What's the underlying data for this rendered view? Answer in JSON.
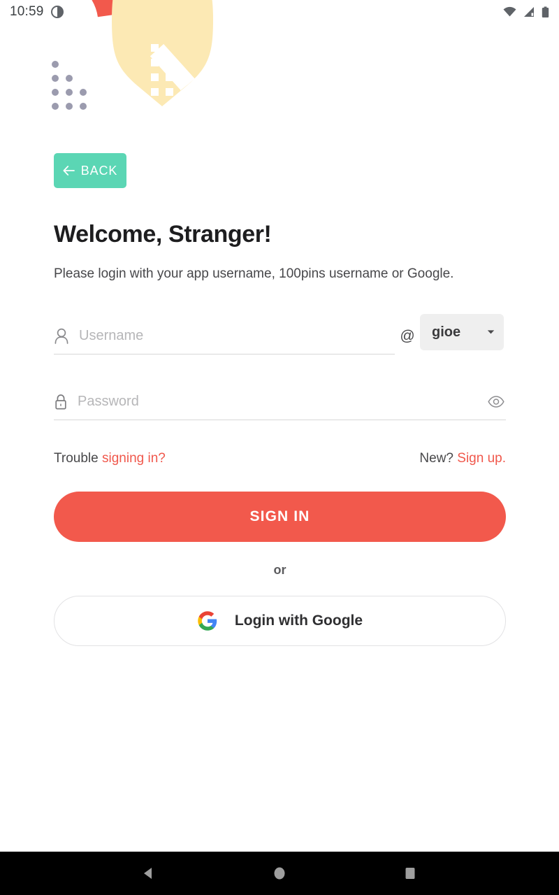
{
  "status_bar": {
    "clock": "10:59",
    "icons": [
      "contrast-circle-icon",
      "wifi-icon",
      "cellular-signal-icon",
      "battery-icon"
    ]
  },
  "header_art": {
    "arc_color": "#F2594C",
    "blob_color": "#FCE9B4",
    "dot_color": "#9B9BAE",
    "inner_dot_color": "#FFFFFF"
  },
  "back_button": {
    "label": "BACK",
    "icon": "arrow-left-icon",
    "color": "#5BD6B4"
  },
  "main": {
    "title": "Welcome, Stranger!",
    "subtitle": "Please login with your app username, 100pins username or Google.",
    "username": {
      "icon": "person-icon",
      "placeholder": "Username",
      "value": "",
      "at_symbol": "@",
      "domain_selected": "gioe",
      "dropdown_icon": "chevron-down-icon"
    },
    "password": {
      "icon": "lock-icon",
      "placeholder": "Password",
      "value": "",
      "reveal_icon": "eye-icon"
    },
    "links": {
      "trouble_prefix": "Trouble ",
      "trouble_link": "signing in?",
      "new_prefix": "New? ",
      "signup_link": "Sign up.",
      "accent_color": "#F0584C"
    },
    "signin_button": {
      "label": "SIGN IN",
      "color": "#F2594C"
    },
    "divider_text": "or",
    "google_button": {
      "label": "Login with Google",
      "icon": "google-logo-icon"
    }
  },
  "nav_bar": {
    "back": "nav-back-icon",
    "home": "nav-home-icon",
    "recents": "nav-recents-icon"
  }
}
